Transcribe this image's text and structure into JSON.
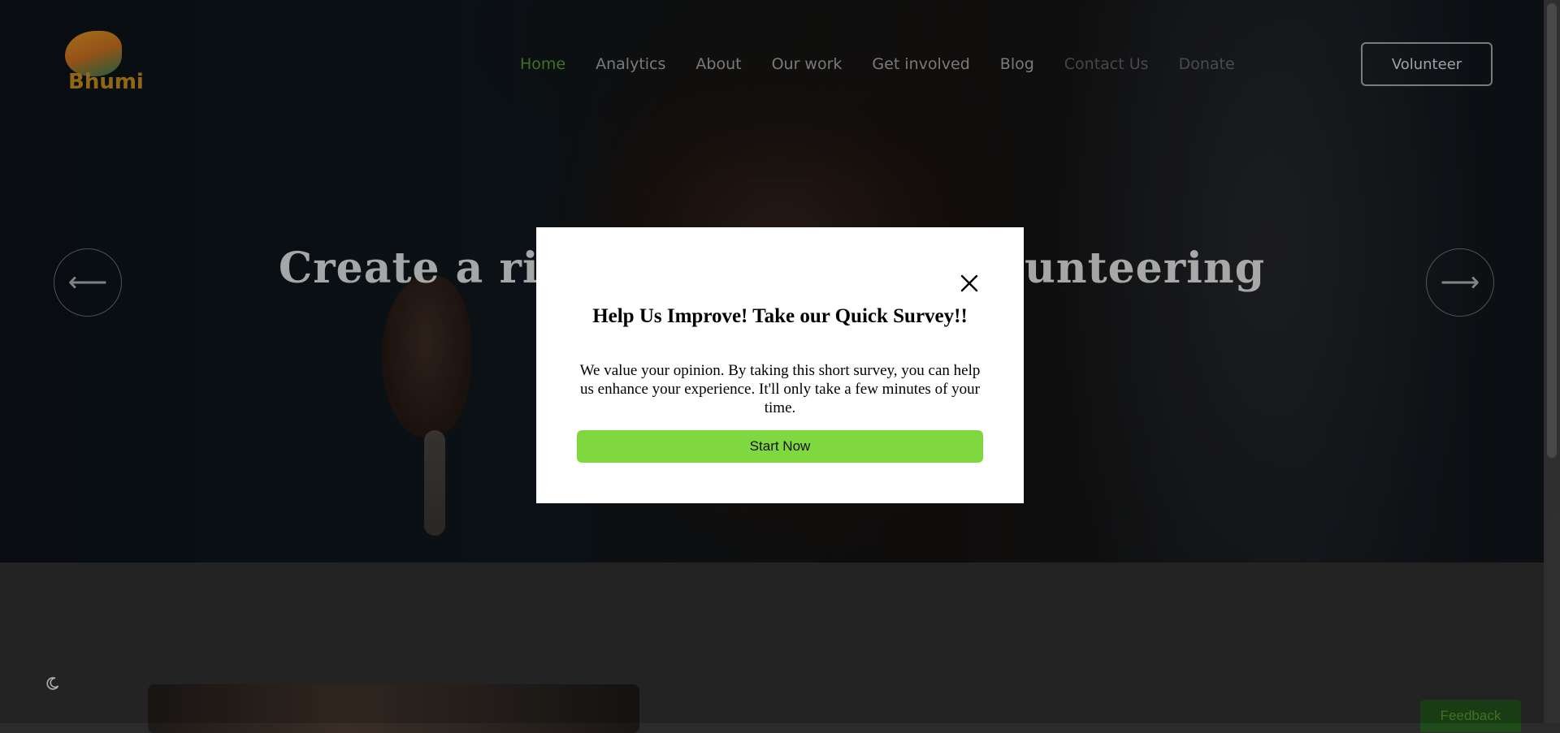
{
  "header": {
    "logo_text": "Bhumi",
    "nav": [
      {
        "label": "Home",
        "state": "active"
      },
      {
        "label": "Analytics",
        "state": "normal"
      },
      {
        "label": "About",
        "state": "normal"
      },
      {
        "label": "Our work",
        "state": "normal"
      },
      {
        "label": "Get involved",
        "state": "normal"
      },
      {
        "label": "Blog",
        "state": "normal"
      },
      {
        "label": "Contact Us",
        "state": "dim"
      },
      {
        "label": "Donate",
        "state": "dim"
      }
    ],
    "volunteer_label": "Volunteer"
  },
  "hero": {
    "title_left": "Create a rip",
    "title_right": "unteering",
    "prev_icon": "arrow-left-icon",
    "next_icon": "arrow-right-icon"
  },
  "theme_toggle_icon": "moon-icon",
  "feedback_label": "Feedback",
  "modal": {
    "title": "Help Us Improve! Take our Quick Survey!!",
    "body": "We value your opinion. By taking this short survey, you can help us enhance your experience. It'll only take a few minutes of your time.",
    "button_label": "Start Now",
    "close_icon": "close-icon",
    "button_color": "#7fd840"
  },
  "colors": {
    "accent_green": "#4c8a2b",
    "button_green": "#7fd840"
  }
}
